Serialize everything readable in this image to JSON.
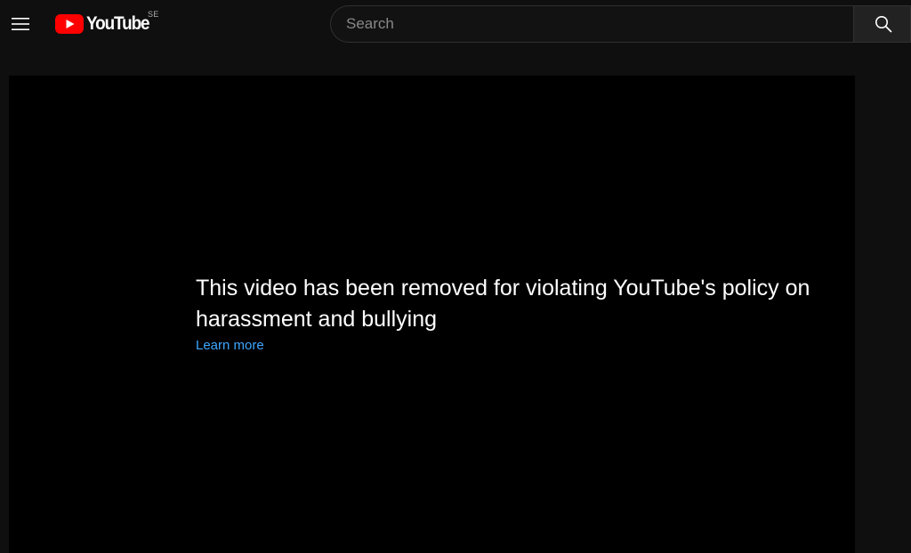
{
  "header": {
    "menu_icon": "hamburger-menu-icon",
    "logo_icon": "youtube-play-icon",
    "logo_text": "YouTube",
    "region_code": "SE",
    "brand_color": "#ff0000"
  },
  "search": {
    "placeholder": "Search",
    "value": "",
    "button_icon": "search-icon"
  },
  "player": {
    "error_message": "This video has been removed for violating YouTube's policy on harassment and bullying",
    "learn_more_label": "Learn more",
    "link_color": "#3ea6ff"
  }
}
